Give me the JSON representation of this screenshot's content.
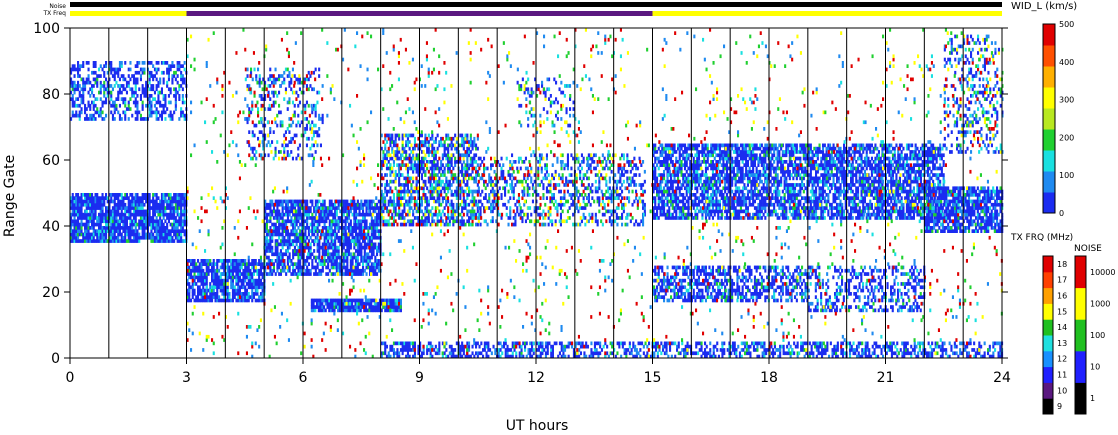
{
  "chart_data": {
    "type": "heatmap",
    "title": "",
    "xlabel": "UT hours",
    "ylabel": "Range Gate",
    "xlim": [
      0,
      24
    ],
    "ylim": [
      0,
      100
    ],
    "x_ticks": [
      0,
      3,
      6,
      9,
      12,
      15,
      18,
      21,
      24
    ],
    "x_tick_labels": [
      "0",
      "3",
      "6",
      "9",
      "12",
      "15",
      "18",
      "21",
      "24"
    ],
    "y_ticks": [
      0,
      20,
      40,
      60,
      80,
      100
    ],
    "y_tick_labels": [
      "0",
      "20",
      "40",
      "60",
      "80",
      "100"
    ],
    "grid": "vertical hour lines",
    "top_bars": {
      "noise_label": "Noise",
      "txfreq_label": "TX Freq",
      "txfreq_segments": [
        {
          "start": 0,
          "end": 3,
          "color": "#ffff00"
        },
        {
          "start": 3,
          "end": 15,
          "color": "#5a1880"
        },
        {
          "start": 15,
          "end": 24,
          "color": "#ffff00"
        }
      ]
    },
    "colorbars": {
      "width": {
        "label": "WID_L (km/s)",
        "ticks": [
          0,
          100,
          200,
          300,
          400,
          500
        ],
        "tick_labels": [
          "0",
          "100",
          "200",
          "300",
          "400",
          "500"
        ],
        "colors": [
          "#1b2cf0",
          "#1f8af0",
          "#19e0e0",
          "#20d030",
          "#b8e820",
          "#ffff00",
          "#ffb000",
          "#ff5000",
          "#e00000"
        ]
      },
      "txfreq": {
        "label": "TX FRQ (MHz)",
        "tick_labels": [
          "9",
          "10",
          "11",
          "12",
          "13",
          "14",
          "15",
          "16",
          "17",
          "18"
        ],
        "colors": [
          "#000000",
          "#5a1880",
          "#2020ff",
          "#1890ff",
          "#20e0e0",
          "#20c020",
          "#ffff00",
          "#ffa000",
          "#ff4000",
          "#e00000"
        ]
      },
      "noise": {
        "label": "NOISE",
        "tick_labels": [
          "1",
          "10",
          "100",
          "1000",
          "10000"
        ],
        "colors": [
          "#000000",
          "#2020ff",
          "#20c020",
          "#ffff00",
          "#e00000"
        ]
      }
    },
    "series": [
      {
        "bands": [
          {
            "x": [
              0,
              3
            ],
            "y": [
              35,
              50
            ],
            "density": 0.85,
            "palette": "low"
          },
          {
            "x": [
              0,
              3
            ],
            "y": [
              72,
              90
            ],
            "density": 0.45,
            "palette": "low"
          },
          {
            "x": [
              3,
              5
            ],
            "y": [
              17,
              30
            ],
            "density": 0.8,
            "palette": "low"
          },
          {
            "x": [
              5,
              8
            ],
            "y": [
              25,
              48
            ],
            "density": 0.75,
            "palette": "low"
          },
          {
            "x": [
              8,
              10.5
            ],
            "y": [
              40,
              68
            ],
            "density": 0.6,
            "palette": "mixed"
          },
          {
            "x": [
              6.2,
              8.5
            ],
            "y": [
              14,
              18
            ],
            "density": 0.9,
            "palette": "low"
          },
          {
            "x": [
              4.5,
              6.5
            ],
            "y": [
              60,
              88
            ],
            "density": 0.25,
            "palette": "mixed"
          },
          {
            "x": [
              10.5,
              14.8
            ],
            "y": [
              40,
              62
            ],
            "density": 0.35,
            "palette": "mixed"
          },
          {
            "x": [
              11.5,
              13
            ],
            "y": [
              70,
              85
            ],
            "density": 0.2,
            "palette": "mixed"
          },
          {
            "x": [
              15,
              22.5
            ],
            "y": [
              42,
              65
            ],
            "density": 0.7,
            "palette": "low"
          },
          {
            "x": [
              15,
              19
            ],
            "y": [
              17,
              28
            ],
            "density": 0.55,
            "palette": "low"
          },
          {
            "x": [
              19,
              22
            ],
            "y": [
              14,
              28
            ],
            "density": 0.35,
            "palette": "low"
          },
          {
            "x": [
              22,
              24
            ],
            "y": [
              38,
              52
            ],
            "density": 0.75,
            "palette": "low"
          },
          {
            "x": [
              22.5,
              24
            ],
            "y": [
              62,
              98
            ],
            "density": 0.25,
            "palette": "mixed"
          },
          {
            "x": [
              8,
              24
            ],
            "y": [
              0,
              5
            ],
            "density": 0.5,
            "palette": "low"
          },
          {
            "x": [
              3,
              24
            ],
            "y": [
              0,
              100
            ],
            "density": 0.03,
            "palette": "high"
          }
        ]
      }
    ]
  }
}
